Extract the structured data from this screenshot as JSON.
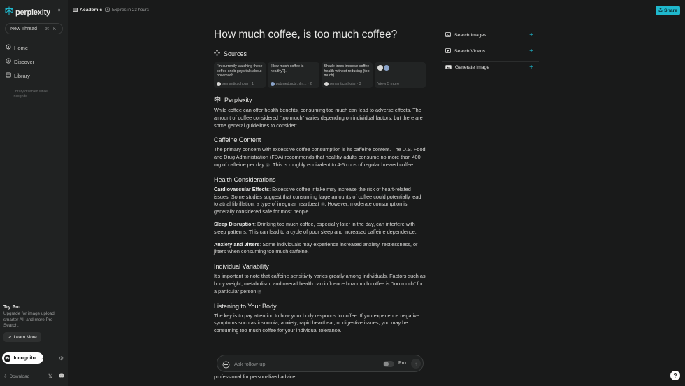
{
  "sidebar": {
    "logo_text": "perplexity",
    "new_thread": "New Thread",
    "new_thread_kbd": "⌘ K",
    "nav": [
      {
        "label": "Home",
        "icon": "search-icon"
      },
      {
        "label": "Discover",
        "icon": "compass-icon"
      },
      {
        "label": "Library",
        "icon": "library-icon"
      }
    ],
    "library_note": "Library disabled while Incognito",
    "try_pro_title": "Try Pro",
    "try_pro_desc": "Upgrade for image upload, smarter AI, and more Pro Search.",
    "learn_more": "Learn More",
    "incognito": "Incognito",
    "download": "Download"
  },
  "topbar": {
    "focus": "Academic",
    "expires": "Expires in 23 hours",
    "share": "Share"
  },
  "thread": {
    "question": "How much coffee, is too much coffee?",
    "sources_label": "Sources",
    "sources": [
      {
        "title": "I'm currently watching these coffee snob guys talk about how much...",
        "meta": "semanticscholar · 1"
      },
      {
        "title": "[How much coffee is healthy?].",
        "meta": "pubmed.ncbi.nlm... · 2"
      },
      {
        "title": "Shade trees improve coffee health without reducing (too much)...",
        "meta": "semanticscholar · 3"
      }
    ],
    "view_more": "View 5 more",
    "answer_label": "Perplexity",
    "intro": "While coffee can offer health benefits, consuming too much can lead to adverse effects. The amount of coffee considered \"too much\" varies depending on individual factors, but there are some general guidelines to consider:",
    "h_caffeine": "Caffeine Content",
    "p_caffeine": "The primary concern with excessive coffee consumption is its caffeine content. The U.S. Food and Drug Administration (FDA) recommends that healthy adults consume no more than 400 mg of caffeine per day",
    "p_caffeine_tail": ". This is roughly equivalent to 4-5 cups of regular brewed coffee.",
    "cite_caffeine": "2",
    "h_health": "Health Considerations",
    "cardio_b": "Cardiovascular Effects",
    "cardio": ": Excessive coffee intake may increase the risk of heart-related issues. Some studies suggest that consuming large amounts of coffee could potentially lead to atrial fibrillation, a type of irregular heartbeat",
    "cardio_tail": ". However, moderate consumption is generally considered safe for most people.",
    "cite_cardio": "5",
    "sleep_b": "Sleep Disruption",
    "sleep": ": Drinking too much coffee, especially later in the day, can interfere with sleep patterns. This can lead to a cycle of poor sleep and increased caffeine dependence.",
    "anx_b": "Anxiety and Jitters",
    "anx": ": Some individuals may experience increased anxiety, restlessness, or jitters when consuming too much caffeine.",
    "h_var": "Individual Variability",
    "p_var": "It's important to note that caffeine sensitivity varies greatly among individuals. Factors such as body weight, metabolism, and overall health can influence how much coffee is \"too much\" for a particular person",
    "cite_var": "8",
    "h_listen": "Listening to Your Body",
    "p_listen": "The key is to pay attention to how your body responds to coffee. If you experience negative symptoms such as insomnia, anxiety, rapid heartbeat, or digestive issues, you may be consuming too much coffee for your individual tolerance.",
    "p_end": "professional for personalized advice."
  },
  "right_panel": {
    "search_images": "Search Images",
    "search_videos": "Search Videos",
    "generate_image": "Generate Image"
  },
  "ask": {
    "placeholder": "Ask follow-up",
    "pro": "Pro"
  },
  "help": "?",
  "colors": {
    "accent": "#1fb8cd",
    "background": "#191a1a",
    "sidebar": "#202222"
  }
}
